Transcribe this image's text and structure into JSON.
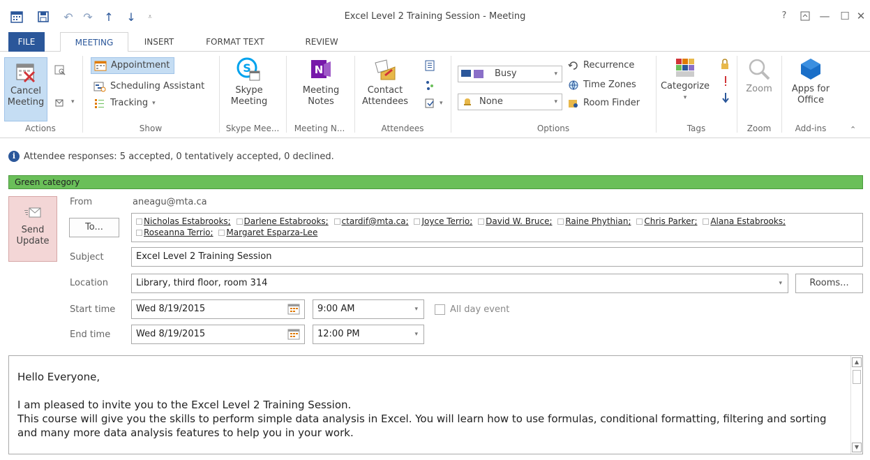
{
  "window": {
    "title": "Excel Level 2 Training Session - Meeting",
    "help": "?",
    "restore": "⌂",
    "minimize": "—",
    "maximize": "☐",
    "close": "✕"
  },
  "tabs": [
    {
      "label": "FILE"
    },
    {
      "label": "MEETING"
    },
    {
      "label": "INSERT"
    },
    {
      "label": "FORMAT TEXT"
    },
    {
      "label": "REVIEW"
    }
  ],
  "ribbon": {
    "actions": {
      "cancel_label": "Cancel Meeting",
      "group": "Actions"
    },
    "show": {
      "appointment": "Appointment",
      "scheduling": "Scheduling Assistant",
      "tracking": "Tracking",
      "group": "Show"
    },
    "skype": {
      "label": "Skype Meeting",
      "group": "Skype Mee..."
    },
    "notes": {
      "label": "Meeting Notes",
      "group": "Meeting N..."
    },
    "attendees": {
      "label": "Contact Attendees",
      "group": "Attendees"
    },
    "options": {
      "show_as": "Busy",
      "reminder": "None",
      "recurrence": "Recurrence",
      "time_zones": "Time Zones",
      "room_finder": "Room Finder",
      "group": "Options"
    },
    "tags": {
      "categorize": "Categorize",
      "group": "Tags"
    },
    "zoom": {
      "label": "Zoom",
      "group": "Zoom"
    },
    "addins": {
      "label": "Apps for Office",
      "group": "Add-ins"
    }
  },
  "info": {
    "responses": "Attendee responses: 5 accepted, 0 tentatively accepted, 0 declined."
  },
  "category": {
    "label": "Green category",
    "color": "#6abf59"
  },
  "form": {
    "send_update": "Send Update",
    "from_label": "From",
    "from_value": "aneagu@mta.ca",
    "to_button": "To...",
    "recipients": [
      "Nicholas Estabrooks;",
      "Darlene Estabrooks;",
      "ctardif@mta.ca;",
      "Joyce Terrio;",
      "David W. Bruce;",
      "Raine Phythian;",
      "Chris Parker;",
      "Alana Estabrooks;",
      "Roseanna Terrio;",
      "Margaret Esparza-Lee"
    ],
    "subject_label": "Subject",
    "subject_value": "Excel Level 2 Training Session",
    "location_label": "Location",
    "location_value": "Library, third floor, room 314",
    "rooms_button": "Rooms...",
    "start_label": "Start time",
    "start_date": "Wed 8/19/2015",
    "start_time": "9:00 AM",
    "all_day_label": "All day event",
    "end_label": "End time",
    "end_date": "Wed 8/19/2015",
    "end_time": "12:00 PM"
  },
  "body": {
    "greeting": "Hello Everyone,",
    "line1": "I am pleased to invite you to the Excel Level 2 Training Session.",
    "line2": "This course will give you the skills to perform simple data analysis in Excel. You will learn how to use formulas, conditional formatting, filtering and sorting and many more data analysis features to help you in your work."
  }
}
